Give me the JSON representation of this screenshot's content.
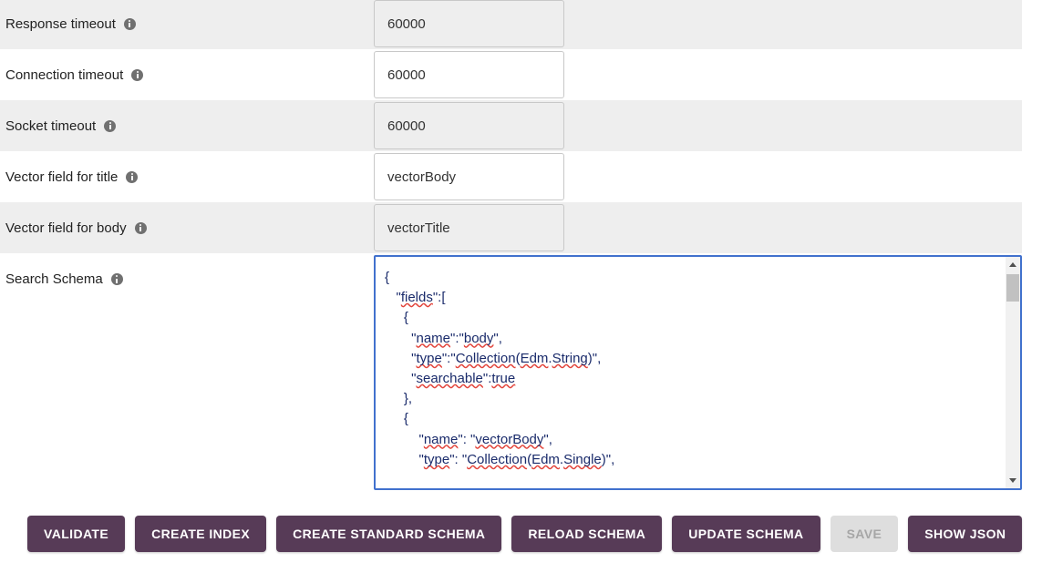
{
  "form": {
    "rows": [
      {
        "label": "Response timeout",
        "info_icon": "info-icon",
        "value": "60000",
        "name": "response-timeout"
      },
      {
        "label": "Connection timeout",
        "info_icon": "info-icon",
        "value": "60000",
        "name": "connection-timeout"
      },
      {
        "label": "Socket timeout",
        "info_icon": "info-icon",
        "value": "60000",
        "name": "socket-timeout"
      },
      {
        "label": "Vector field for title",
        "info_icon": "info-icon",
        "value": "vectorBody",
        "name": "vector-field-title"
      },
      {
        "label": "Vector field for body",
        "info_icon": "info-icon",
        "value": "vectorTitle",
        "name": "vector-field-body"
      }
    ],
    "schema": {
      "label": "Search Schema",
      "info_icon": "info-icon",
      "lines": [
        "{",
        "   \"fields\":[",
        "     {",
        "       \"name\":\"body\",",
        "       \"type\":\"Collection(Edm.String)\",",
        "       \"searchable\":true",
        "     },",
        "     {",
        "         \"name\": \"vectorBody\",",
        "         \"type\": \"Collection(Edm.Single)\","
      ],
      "value": "{\n   \"fields\":[\n     {\n       \"name\":\"body\",\n       \"type\":\"Collection(Edm.String)\",\n       \"searchable\":true\n     },\n     {\n         \"name\": \"vectorBody\",\n         \"type\": \"Collection(Edm.Single)\",",
      "scrollbar": {
        "up_icon": "chevron-up-icon",
        "down_icon": "chevron-down-icon"
      }
    }
  },
  "buttons": [
    {
      "label": "Validate",
      "name": "validate-button",
      "disabled": false
    },
    {
      "label": "Create index",
      "name": "create-index-button",
      "disabled": false
    },
    {
      "label": "Create standard schema",
      "name": "create-standard-schema-button",
      "disabled": false
    },
    {
      "label": "Reload schema",
      "name": "reload-schema-button",
      "disabled": false
    },
    {
      "label": "Update schema",
      "name": "update-schema-button",
      "disabled": false
    },
    {
      "label": "Save",
      "name": "save-button",
      "disabled": true
    },
    {
      "label": "Show JSON",
      "name": "show-json-button",
      "disabled": false
    }
  ],
  "colors": {
    "button_purple": "#573b57",
    "button_disabled_bg": "#dedede",
    "button_disabled_text": "#a6a6a6",
    "row_striped_bg": "#eeeeee",
    "focus_border": "#4171cd",
    "json_text": "#1a2b6b",
    "spellcheck_underline": "#e2443b"
  }
}
